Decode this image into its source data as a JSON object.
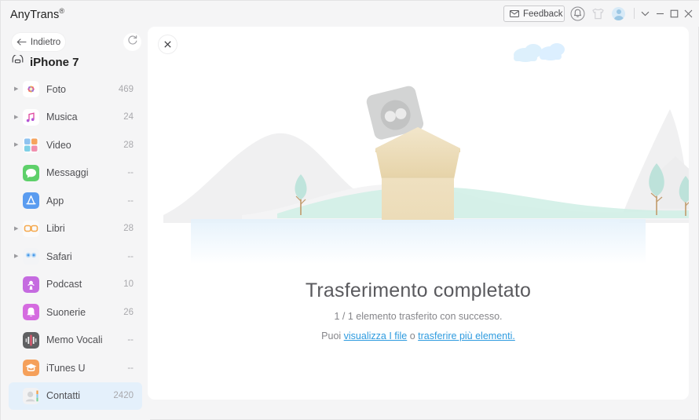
{
  "window": {
    "app_title": "AnyTrans",
    "registered_mark": "®",
    "controls": {
      "feedback_label": "Feedback",
      "feedback_icon": "envelope-icon",
      "bell_icon": "bell-icon",
      "shirt_icon": "shirt-icon",
      "avatar_icon": "avatar-icon",
      "chevron_icon": "chevron-down-icon",
      "minimize_icon": "minimize-icon",
      "maximize_icon": "maximize-icon",
      "close_icon": "close-icon"
    }
  },
  "sidebar": {
    "back_label": "Indietro",
    "back_icon": "arrow-left-icon",
    "refresh_icon": "refresh-icon",
    "device_icon": "device-icon",
    "device_name": "iPhone 7",
    "items": [
      {
        "label": "Foto",
        "count": "469",
        "icon": "photos-icon",
        "expandable": true,
        "selected": false
      },
      {
        "label": "Musica",
        "count": "24",
        "icon": "music-icon",
        "expandable": true,
        "selected": false
      },
      {
        "label": "Video",
        "count": "28",
        "icon": "video-icon",
        "expandable": true,
        "selected": false
      },
      {
        "label": "Messaggi",
        "count": "--",
        "icon": "messages-icon",
        "expandable": false,
        "selected": false
      },
      {
        "label": "App",
        "count": "--",
        "icon": "appstore-icon",
        "expandable": false,
        "selected": false
      },
      {
        "label": "Libri",
        "count": "28",
        "icon": "books-icon",
        "expandable": true,
        "selected": false
      },
      {
        "label": "Safari",
        "count": "--",
        "icon": "safari-icon",
        "expandable": true,
        "selected": false
      },
      {
        "label": "Podcast",
        "count": "10",
        "icon": "podcast-icon",
        "expandable": false,
        "selected": false
      },
      {
        "label": "Suonerie",
        "count": "26",
        "icon": "ringtones-icon",
        "expandable": false,
        "selected": false
      },
      {
        "label": "Memo Vocali",
        "count": "--",
        "icon": "voicememo-icon",
        "expandable": false,
        "selected": false
      },
      {
        "label": "iTunes U",
        "count": "--",
        "icon": "itunesu-icon",
        "expandable": false,
        "selected": false
      },
      {
        "label": "Contatti",
        "count": "2420",
        "icon": "contacts-icon",
        "expandable": false,
        "selected": true
      }
    ]
  },
  "main": {
    "close_icon": "close-icon",
    "illustration": "transfer-complete-box-scene",
    "title": "Trasferimento completato",
    "subtitle": "1 / 1 elemento trasferito con successo.",
    "links_prefix": "Puoi ",
    "link_view": "visualizza I file",
    "links_middle": " o ",
    "link_more": "trasferire più elementi.",
    "links_suffix": ""
  },
  "colors": {
    "accent_link": "#2e9bdf",
    "selected_row": "#e4f0fb",
    "window_bg": "#f5f5f6",
    "panel_bg": "#ffffff",
    "title_text": "#5a5a5e"
  }
}
